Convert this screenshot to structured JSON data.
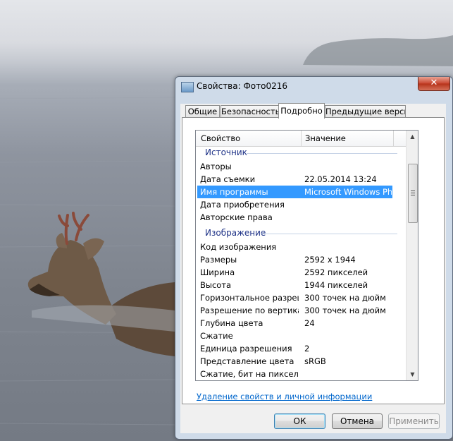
{
  "window": {
    "title": "Свойства: Фото0216",
    "close_symbol": "✕",
    "icon": "image-file-icon"
  },
  "tabs": [
    {
      "label": "Общие"
    },
    {
      "label": "Безопасность"
    },
    {
      "label": "Подробно",
      "active": true
    },
    {
      "label": "Предыдущие версии"
    }
  ],
  "table": {
    "col_property": "Свойство",
    "col_value": "Значение",
    "group_source": "Источник",
    "group_image": "Изображение",
    "source_rows": [
      {
        "k": "Авторы",
        "v": ""
      },
      {
        "k": "Дата съемки",
        "v": "22.05.2014 13:24"
      },
      {
        "k": "Имя программы",
        "v": "Microsoft Windows Ph..."
      },
      {
        "k": "Дата приобретения",
        "v": ""
      },
      {
        "k": "Авторские права",
        "v": ""
      }
    ],
    "image_rows": [
      {
        "k": "Код изображения",
        "v": ""
      },
      {
        "k": "Размеры",
        "v": "2592 x 1944"
      },
      {
        "k": "Ширина",
        "v": "2592 пикселей"
      },
      {
        "k": "Высота",
        "v": "1944 пикселей"
      },
      {
        "k": "Горизонтальное разреше...",
        "v": "300 точек на дюйм"
      },
      {
        "k": "Разрешение по вертикали",
        "v": "300 точек на дюйм"
      },
      {
        "k": "Глубина цвета",
        "v": "24"
      },
      {
        "k": "Сжатие",
        "v": ""
      },
      {
        "k": "Единица разрешения",
        "v": "2"
      },
      {
        "k": "Представление цвета",
        "v": "sRGB"
      },
      {
        "k": "Сжатие, бит на пиксель",
        "v": ""
      }
    ]
  },
  "scroll": {
    "up": "▲",
    "down": "▼"
  },
  "link": "Удаление свойств и личной информации",
  "buttons": {
    "ok": "ОК",
    "cancel": "Отмена",
    "apply": "Применить"
  },
  "colors": {
    "selection": "#3399ff",
    "group_text": "#1e3287",
    "link": "#0066cc"
  }
}
